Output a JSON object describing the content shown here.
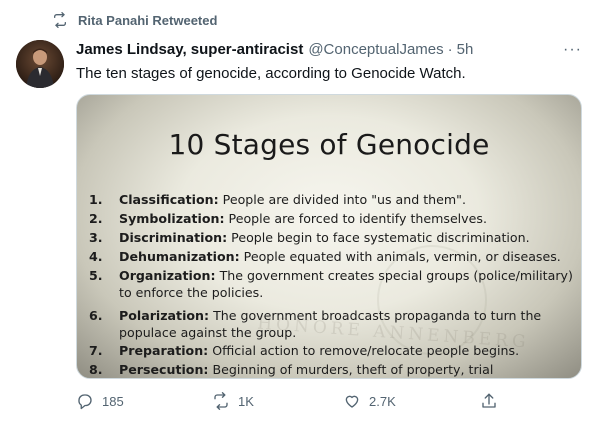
{
  "retweet": {
    "icon": "retweet-icon",
    "label": "Rita Panahi Retweeted"
  },
  "author": {
    "name": "James Lindsay, super-antiracist",
    "handle": "@ConceptualJames",
    "separator": "·",
    "time": "5h",
    "avatar_icon": "avatar-photo"
  },
  "more_label": "···",
  "text": "The ten stages of genocide, according to Genocide Watch.",
  "media": {
    "title": "10 Stages of Genocide",
    "watermark": "HONORE ANNENBERG",
    "stages": [
      {
        "num": "1.",
        "term": "Classification:",
        "desc": "People are divided into \"us and them\"."
      },
      {
        "num": "2.",
        "term": "Symbolization:",
        "desc": "People are forced to identify themselves."
      },
      {
        "num": "3.",
        "term": "Discrimination:",
        "desc": "People begin to face systematic discrimination."
      },
      {
        "num": "4.",
        "term": "Dehumanization:",
        "desc": "People equated with animals, vermin, or diseases."
      },
      {
        "num": "5.",
        "term": "Organization:",
        "desc": "The government creates special groups (police/military) to enforce the policies."
      },
      {
        "num": "6.",
        "term": "Polarization:",
        "desc": "The government broadcasts propaganda to turn the populace against the group."
      },
      {
        "num": "7.",
        "term": "Preparation:",
        "desc": "Official action to remove/relocate people begins."
      },
      {
        "num": "8.",
        "term": "Persecution:",
        "desc": "Beginning of murders, theft of property, trial"
      }
    ]
  },
  "actions": {
    "reply": {
      "icon": "reply-icon",
      "count": "185"
    },
    "retweet": {
      "icon": "retweet-icon",
      "count": "1K"
    },
    "like": {
      "icon": "like-heart-icon",
      "count": "2.7K"
    },
    "share": {
      "icon": "share-icon"
    }
  },
  "colors": {
    "secondary_text": "#536471",
    "primary_text": "#0f1419"
  }
}
